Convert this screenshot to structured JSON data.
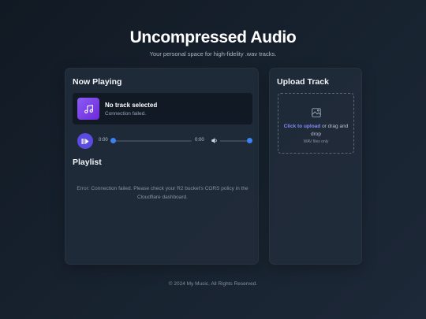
{
  "header": {
    "title": "Uncompressed Audio",
    "subtitle": "Your personal space for high-fidelity .wav tracks."
  },
  "player": {
    "heading": "Now Playing",
    "track_title": "No track selected",
    "track_status": "Connection failed.",
    "album_icon": "music-note-icon",
    "play_icon": "play-pause-icon",
    "current_time": "0:00",
    "duration": "0:00",
    "progress": 0,
    "volume_icon": "volume-icon",
    "volume": 1.0
  },
  "playlist": {
    "heading": "Playlist",
    "error": "Error: Connection failed. Please check your R2 bucket's CORS policy in the Cloudflare dashboard."
  },
  "upload": {
    "heading": "Upload Track",
    "icon": "image-icon",
    "link_text": "Click to upload",
    "rest_text": " or drag and drop",
    "hint": "WAV files only"
  },
  "footer": {
    "text": "© 2024 My Music. All Rights Reserved."
  },
  "colors": {
    "accent": "#5b4be0",
    "slider": "#3b82f6",
    "link": "#818cf8",
    "album_art": "#7c3aed"
  }
}
